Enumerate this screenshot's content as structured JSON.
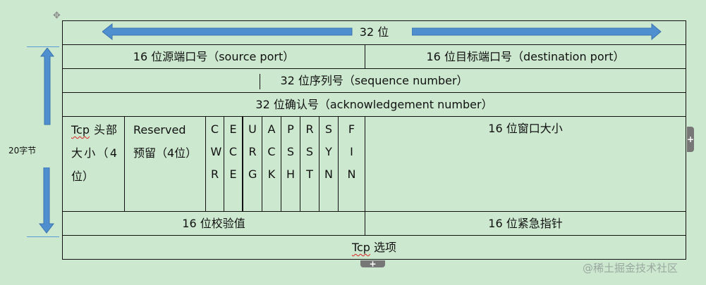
{
  "header": {
    "width_label": "32 位"
  },
  "side": {
    "length_label": "20字节"
  },
  "rows": {
    "source_port": "16 位源端口号（source port）",
    "destination_port": "16 位目标端口号（destination port）",
    "sequence": "32 位序列号（sequence number）",
    "ack": "32 位确认号（acknowledgement number）",
    "header_len_word": "Tcp",
    "header_len_rest": " 头部 大小（4位）",
    "reserved": "Reserved 预留（4位）",
    "flags": [
      "CWR",
      "ECE",
      "URG",
      "ACK",
      "PSH",
      "RST",
      "SYN",
      "FIN"
    ],
    "window": "16 位窗口大小",
    "checksum": "16 位校验值",
    "urgent": "16 位紧急指针",
    "options_word": "Tcp",
    "options_rest": " 选项"
  },
  "watermark": "@稀土掘金技术社区",
  "colors": {
    "background": "#cce8cf",
    "arrow": "#4f8fd0"
  }
}
